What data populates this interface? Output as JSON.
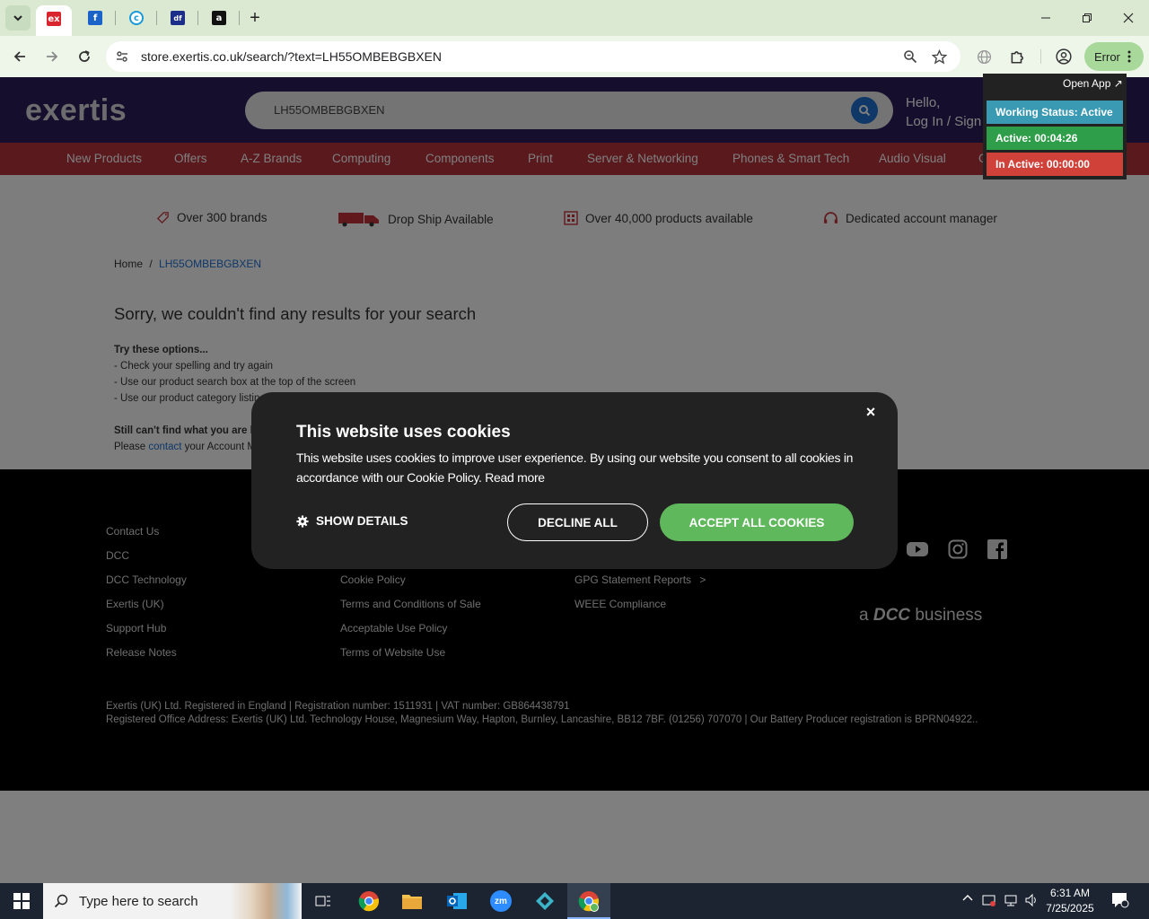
{
  "browser": {
    "url": "store.exertis.co.uk/search/?text=LH55OMBEBGBXEN",
    "profile_button": "Error",
    "tabs": [
      {
        "favicon": "exertis",
        "active": true
      },
      {
        "favicon": "blue-f"
      },
      {
        "favicon": "c-circle"
      },
      {
        "favicon": "df"
      },
      {
        "favicon": "amazon-a"
      }
    ],
    "new_tab": "+"
  },
  "extension": {
    "open_app": "Open App ↗",
    "working_status": "Working Status: Active",
    "active": "Active: 00:04:26",
    "inactive": "In Active: 00:00:00"
  },
  "site": {
    "logo": "exertis",
    "search_value": "LH55OMBEBGBXEN",
    "hello": "Hello,",
    "login": "Log In / Sign Up",
    "categories": [
      "New Products",
      "Offers",
      "A-Z Brands",
      "Computing",
      "Components",
      "Print",
      "Server & Networking",
      "Phones & Smart Tech",
      "Audio Visual",
      "G"
    ],
    "usps": [
      "Over 300 brands",
      "Drop Ship Available",
      "Over 40,000 products available",
      "Dedicated account manager"
    ],
    "breadcrumb": {
      "home": "Home",
      "sep": "/",
      "current": "LH55OMBEBGBXEN"
    },
    "no_results": "Sorry, we couldn't find any results for your search",
    "tips_title": "Try these options...",
    "tips": [
      "- Check your spelling and try again",
      "- Use our product search box at the top of the screen",
      "- Use our product category listin"
    ],
    "still_title": "Still can't find what you are lo",
    "still_prefix": "Please",
    "still_link": "contact",
    "still_suffix": "your Account M"
  },
  "footer": {
    "col1": [
      "Contact Us",
      "DCC",
      "DCC Technology",
      "Exertis (UK)",
      "Support Hub",
      "Release Notes"
    ],
    "col2": [
      "Cookie Policy",
      "Terms and Conditions of Sale",
      "Acceptable Use Policy",
      "Terms of Website Use"
    ],
    "col3": [
      "GPG Statement Reports",
      "WEEE Compliance"
    ],
    "col3_arrow": ">",
    "dcc_prefix": "a",
    "dcc_name": "DCC",
    "dcc_suffix": "business",
    "legal1": "Exertis (UK) Ltd. Registered in England | Registration number: 1511931 | VAT number: GB864438791",
    "legal2": "Registered Office Address: Exertis (UK) Ltd. Technology House, Magnesium Way, Hapton, Burnley, Lancashire, BB12 7BF. (01256) 707070 | Our Battery Producer registration is BPRN04922.."
  },
  "cookie": {
    "title": "This website uses cookies",
    "body": "This website uses cookies to improve user experience. By using our website you consent to all cookies in accordance with our Cookie Policy. Read more",
    "show_details": "SHOW DETAILS",
    "decline": "DECLINE ALL",
    "accept": "ACCEPT ALL COOKIES",
    "close": "×"
  },
  "taskbar": {
    "search_placeholder": "Type here to search",
    "time": "6:31 AM",
    "date": "7/25/2025"
  },
  "colors": {
    "header": "#2a1f5a",
    "nav": "#b3323a",
    "accept": "#5fb85b",
    "working": "#3a9ab4",
    "active": "#2f9e4a",
    "inactive": "#d0413a"
  }
}
